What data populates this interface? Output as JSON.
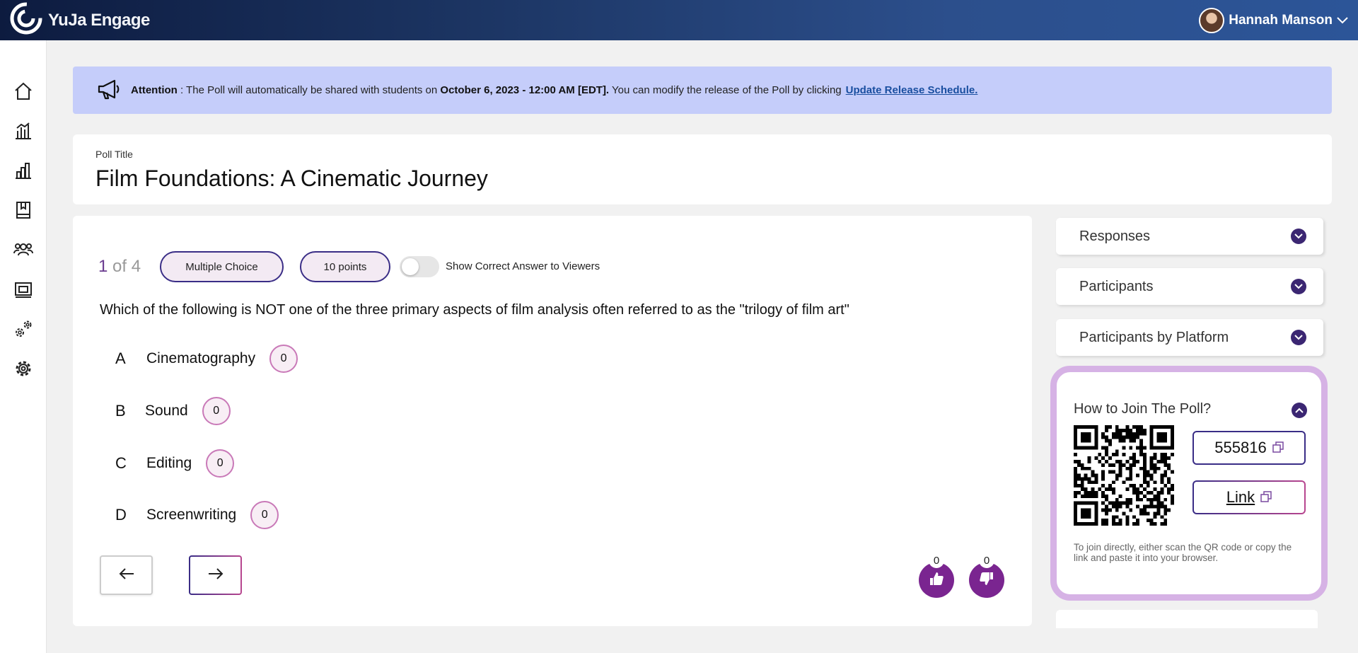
{
  "app": {
    "name": "YuJa Engage"
  },
  "user": {
    "name": "Hannah Manson"
  },
  "sidebar": {
    "items": [
      {
        "name": "home-icon"
      },
      {
        "name": "analytics-icon"
      },
      {
        "name": "reports-icon"
      },
      {
        "name": "gradebook-icon"
      },
      {
        "name": "users-icon"
      },
      {
        "name": "courses-icon"
      },
      {
        "name": "integrations-icon"
      },
      {
        "name": "settings-icon"
      }
    ]
  },
  "banner": {
    "label": "Attention",
    "text_before": " : The Poll will automatically be shared with students on ",
    "date": "October 6, 2023 - 12:00 AM [EDT].",
    "text_after": " You can modify the release of the Poll by clicking",
    "link": "Update Release Schedule."
  },
  "poll": {
    "title_label": "Poll Title",
    "title": "Film Foundations: A Cinematic Journey"
  },
  "question": {
    "current": "1",
    "of_total": " of 4",
    "type": "Multiple Choice",
    "points": "10 points",
    "show_answer_label": "Show Correct Answer to Viewers",
    "show_answer_enabled": false,
    "text": "Which of the following is NOT one of the three primary aspects of film analysis often referred to as the \"trilogy of film art\"",
    "options": [
      {
        "letter": "A",
        "text": "Cinematography",
        "count": "0"
      },
      {
        "letter": "B",
        "text": "Sound",
        "count": "0"
      },
      {
        "letter": "C",
        "text": "Editing",
        "count": "0"
      },
      {
        "letter": "D",
        "text": "Screenwriting",
        "count": "0"
      }
    ],
    "likes": "0",
    "dislikes": "0"
  },
  "panel": {
    "responses": "Responses",
    "participants": "Participants",
    "participants_by_platform": "Participants by Platform",
    "join": {
      "title": "How to Join The Poll?",
      "code": "555816",
      "link": "Link",
      "note": "To join directly, either scan the QR code or copy the link and paste it into your browser."
    }
  },
  "colors": {
    "accent": "#3a2d86",
    "react": "#7a2590",
    "banner_bg": "#c5cdfa",
    "join_border": "#d6b2e5"
  }
}
